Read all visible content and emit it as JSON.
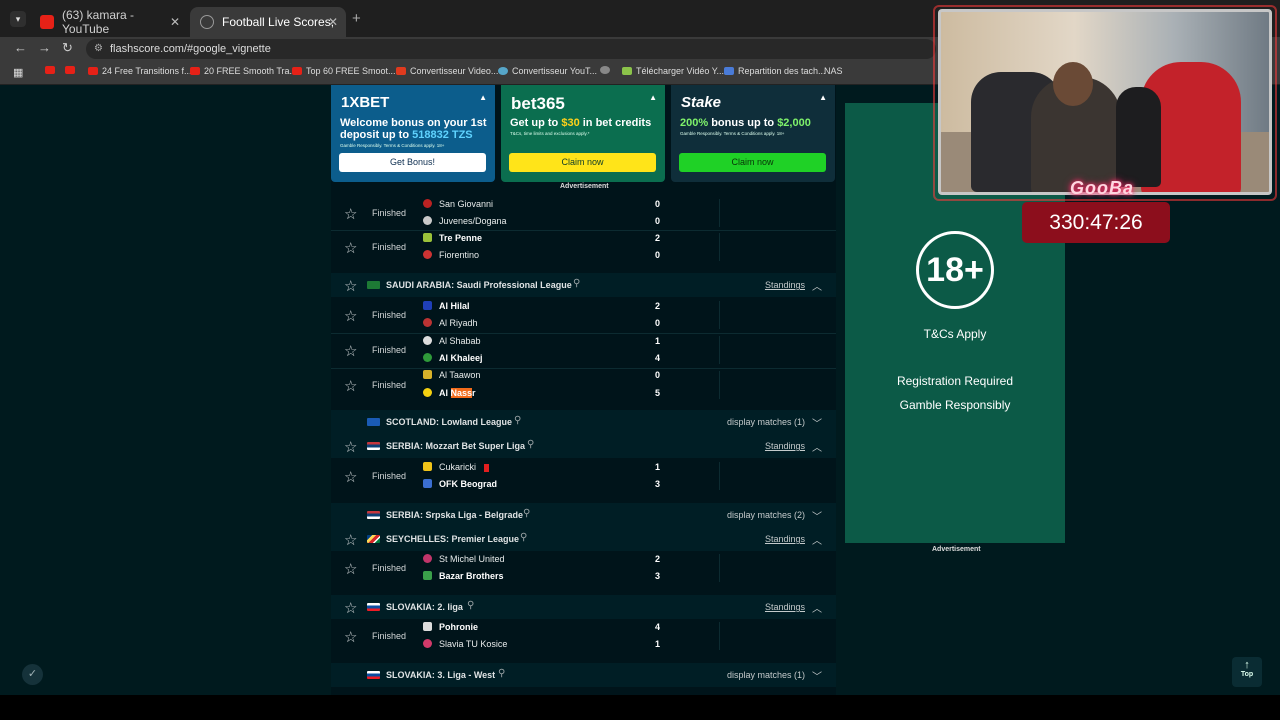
{
  "browser": {
    "tabs": [
      {
        "title": "(63) kamara - YouTube"
      },
      {
        "title": "Football Live Scores, Latest Foo"
      }
    ],
    "url": "flashscore.com/#google_vignette",
    "bookmarks": [
      "24 Free Transitions f...",
      "20 FREE Smooth Tra...",
      "Top 60 FREE Smoot...",
      "Convertisseur Video...",
      "Convertisseur YouT...",
      "Télécharger Vidéo Y...",
      "Repartition des tach...",
      "NAS"
    ]
  },
  "ads": {
    "label": "Advertisement",
    "cards": [
      {
        "brand": "1XBET",
        "headline_pre": "Welcome bonus on your 1st deposit up to ",
        "headline_hl": "518832 TZS",
        "fine": "Gamble Responsibly. Terms & Conditions apply. 18+",
        "cta": "Get Bonus!",
        "bg": "#0c5d8c",
        "cta_bg": "#ffffff",
        "cta_color": "#0c2d4f"
      },
      {
        "brand": "bet365",
        "headline_pre": "Get up to ",
        "headline_hl": "$30",
        "headline_post": " in bet credits",
        "fine": "T&Cs, time limits and exclusions apply.*",
        "cta": "Claim now",
        "bg": "#0b6e4f",
        "cta_bg": "#ffe419",
        "cta_color": "#0b3a2a"
      },
      {
        "brand": "Stake",
        "headline_hl": "200%",
        "headline_post": " bonus up to ",
        "headline_hl2": "$2,000",
        "fine": "Gamble Responsibly. Terms & Conditions apply. 18+",
        "cta": "Claim now",
        "bg": "#0f2e3a",
        "cta_bg": "#1fd126",
        "cta_color": "#083308"
      }
    ]
  },
  "matches_top": [
    {
      "status": "Finished",
      "home": "San Giovanni",
      "away": "Juvenes/Dogana",
      "home_score": "0",
      "away_score": "0",
      "home_bold": false,
      "away_bold": false
    },
    {
      "status": "Finished",
      "home": "Tre Penne",
      "away": "Fiorentino",
      "home_score": "2",
      "away_score": "0",
      "home_bold": true,
      "away_bold": false
    }
  ],
  "league_saudi": {
    "name": "SAUDI ARABIA: Saudi Professional League",
    "right": "Standings"
  },
  "matches_saudi": [
    {
      "status": "Finished",
      "home": "Al Hilal",
      "away": "Al Riyadh",
      "home_score": "2",
      "away_score": "0"
    },
    {
      "status": "Finished",
      "home": "Al Shabab",
      "away": "Al Khaleej",
      "home_score": "1",
      "away_score": "4"
    },
    {
      "status": "Finished",
      "home": "Al Taawon",
      "away_pre": "Al ",
      "away_hl": "Nass",
      "away_post": "r",
      "home_score": "0",
      "away_score": "5"
    }
  ],
  "league_scotland": {
    "name": "SCOTLAND: Lowland League",
    "right": "display matches (1)"
  },
  "league_serbia1": {
    "name": "SERBIA: Mozzart Bet Super Liga",
    "right": "Standings"
  },
  "match_serbia": {
    "status": "Finished",
    "home": "Cukaricki",
    "away": "OFK Beograd",
    "home_score": "1",
    "away_score": "3"
  },
  "league_serbia2": {
    "name": "SERBIA: Srpska Liga - Belgrade",
    "right": "display matches (2)"
  },
  "league_seychelles": {
    "name": "SEYCHELLES: Premier League",
    "right": "Standings"
  },
  "match_seychelles": {
    "status": "Finished",
    "home": "St Michel United",
    "away": "Bazar Brothers",
    "home_score": "2",
    "away_score": "3"
  },
  "league_slovakia2": {
    "name": "SLOVAKIA: 2. liga",
    "right": "Standings"
  },
  "match_slovakia": {
    "status": "Finished",
    "home": "Pohronie",
    "away": "Slavia TU Kosice",
    "home_score": "4",
    "away_score": "1"
  },
  "league_slovakia3": {
    "name": "SLOVAKIA: 3. Liga - West",
    "right": "display matches (1)"
  },
  "right_ad": {
    "age": "18+",
    "tcs": "T&Cs Apply",
    "reg": "Registration Required",
    "gamble": "Gamble Responsibly",
    "label": "Advertisement"
  },
  "overlay": {
    "name": "GooBa",
    "timer": "330:47:26"
  },
  "top_button": "Top"
}
